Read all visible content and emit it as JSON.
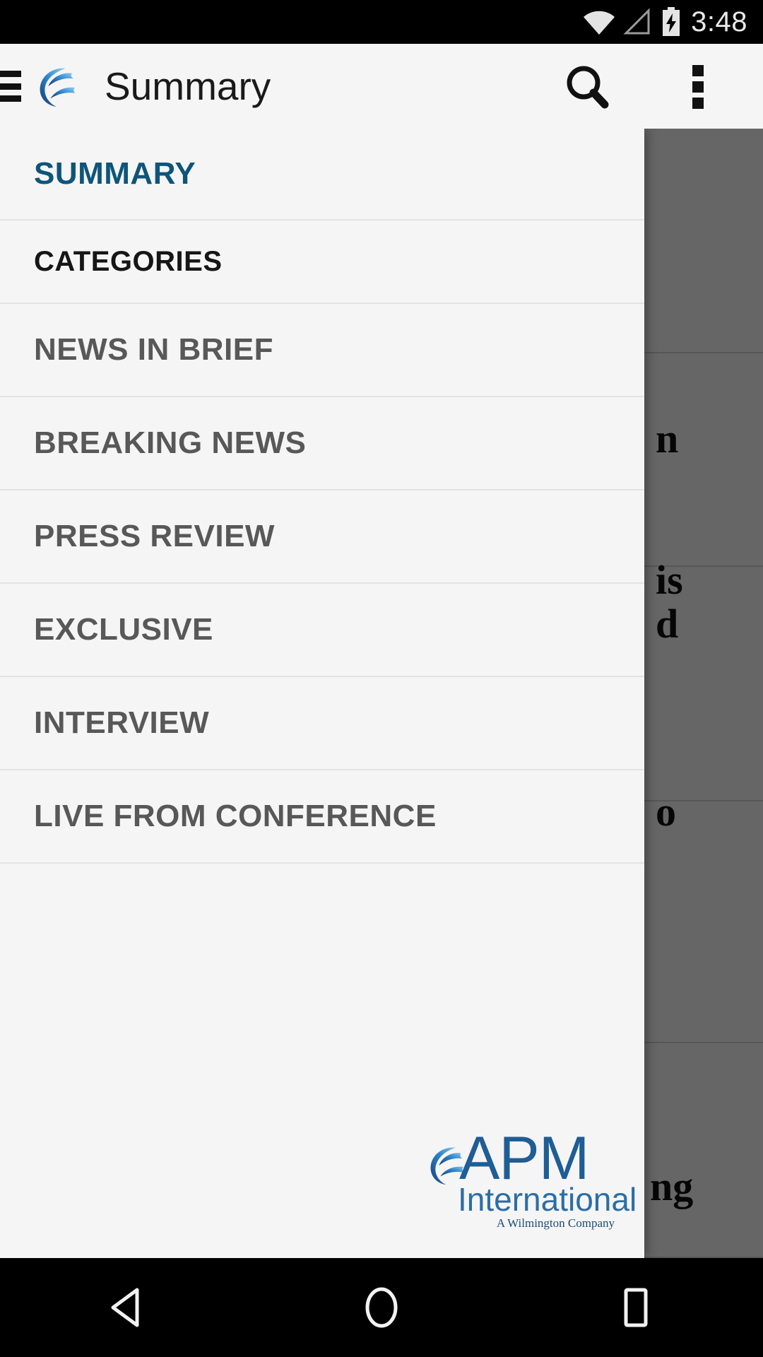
{
  "status_bar": {
    "clock": "3:48",
    "icons": [
      "wifi-icon",
      "cell-signal-icon",
      "battery-charging-icon"
    ]
  },
  "app_bar": {
    "menu_icon": "hamburger-menu-icon",
    "logo_icon": "apm-swirl-logo-icon",
    "title": "Summary",
    "search_icon": "search-icon",
    "overflow_icon": "overflow-menu-icon"
  },
  "drawer": {
    "summary_item": {
      "label": "SUMMARY"
    },
    "categories_header": {
      "label": "CATEGORIES"
    },
    "categories": [
      {
        "label": "NEWS IN BRIEF"
      },
      {
        "label": "BREAKING NEWS"
      },
      {
        "label": "PRESS REVIEW"
      },
      {
        "label": "EXCLUSIVE"
      },
      {
        "label": "INTERVIEW"
      },
      {
        "label": "LIVE FROM CONFERENCE"
      }
    ],
    "footer_logo": {
      "name": "APM",
      "subtitle": "International",
      "tagline": "A Wilmington Company"
    }
  },
  "background": {
    "headline_fragments": [
      "n",
      "is",
      "d",
      "o",
      "ng"
    ]
  },
  "nav_bar": {
    "back_label": "back-button",
    "home_label": "home-button",
    "recents_label": "recents-button"
  },
  "colors": {
    "accent": "#0e5579",
    "category_text": "#585858",
    "drawer_bg": "#f5f5f5",
    "logo_blue": "#1f5d96"
  }
}
